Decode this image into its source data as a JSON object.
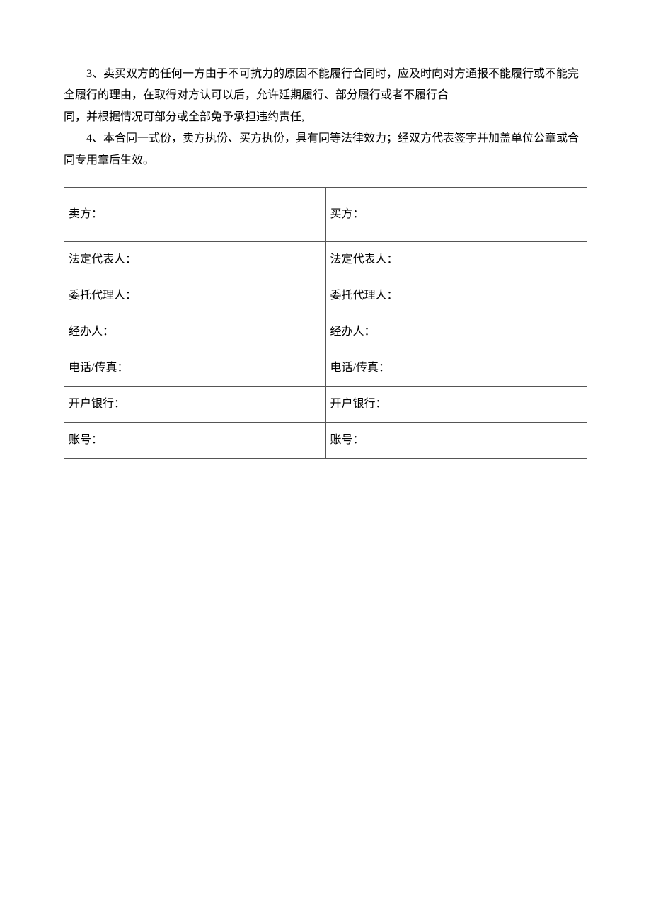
{
  "paragraphs": {
    "p3_line1": "3、卖买双方的任何一方由于不可抗力的原因不能履行合同时，应及时向对方通报不能履行或不能完全履行的理由，在取得对方认可以后，允许延期履行、部分履行或者不履行合",
    "p3_line2": "同，并根据情况可部分或全部兔予承担违约责任,",
    "p4": "4、本合同一式份，卖方执份、买方执份，具有同等法律效力；经双方代表签字并加盖单位公章或合同专用章后生效。"
  },
  "table": {
    "rows": [
      {
        "left": "卖方：",
        "right": "买方：",
        "tall": true
      },
      {
        "left": "法定代表人：",
        "right": "法定代表人："
      },
      {
        "left": "委托代理人：",
        "right": "委托代理人："
      },
      {
        "left": "经办人：",
        "right": "经办人："
      },
      {
        "left": "电话/传真：",
        "right": "电话/传真："
      },
      {
        "left": "开户银行：",
        "right": "开户银行："
      },
      {
        "left": "账号：",
        "right": "账号："
      }
    ]
  }
}
